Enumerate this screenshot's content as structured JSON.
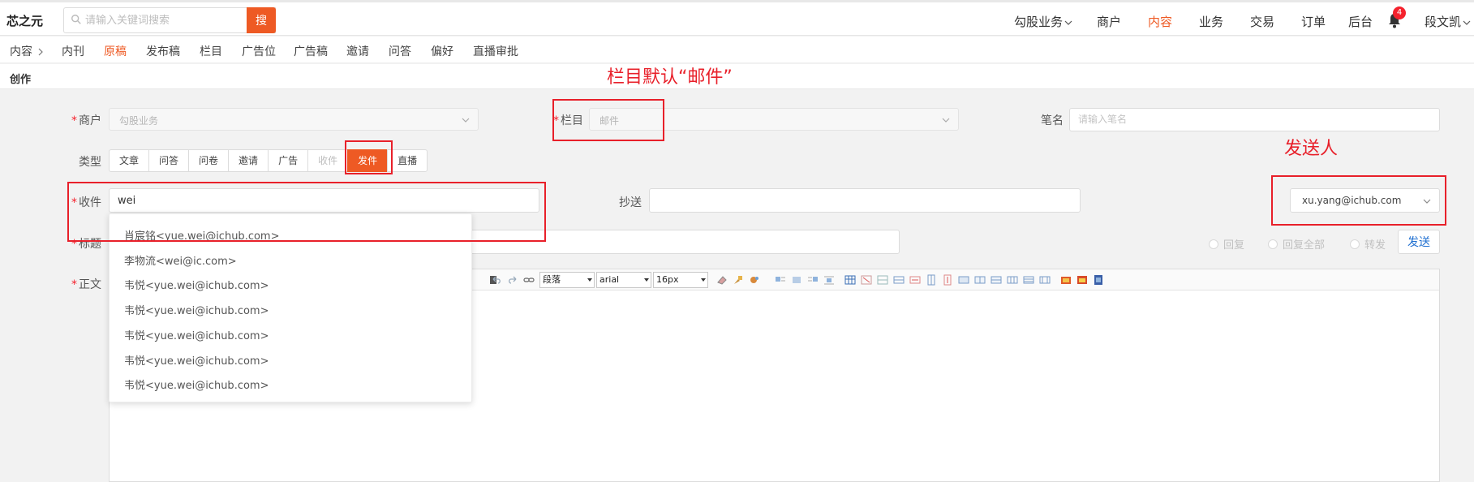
{
  "header": {
    "logo": "芯之元",
    "search_placeholder": "请输入关键词搜索",
    "search_button": "搜",
    "nav": [
      "勾股业务",
      "商户",
      "内容",
      "业务",
      "交易",
      "订单",
      "后台"
    ],
    "notification_count": "4",
    "user_name": "段文凯"
  },
  "subnav": {
    "root": "内容",
    "items": [
      "内刊",
      "原稿",
      "发布稿",
      "栏目",
      "广告位",
      "广告稿",
      "邀请",
      "问答",
      "偏好",
      "直播审批"
    ]
  },
  "page": {
    "title": "创作"
  },
  "form": {
    "merchant_label": "商户",
    "merchant_value": "勾股业务",
    "column_label": "栏目",
    "column_value": "邮件",
    "penname_label": "笔名",
    "penname_placeholder": "请输入笔名",
    "type_label": "类型",
    "types": [
      "文章",
      "问答",
      "问卷",
      "邀请",
      "广告",
      "收件",
      "发件",
      "直播"
    ],
    "recipient_label": "收件",
    "recipient_value": "wei",
    "cc_label": "抄送",
    "sender_value": "xu.yang@ichub.com",
    "title_label": "标题",
    "reply_options": [
      "回复",
      "回复全部",
      "转发"
    ],
    "send_button": "发送",
    "body_label": "正文"
  },
  "editor": {
    "paragraph": "段落",
    "font": "arial",
    "size": "16px"
  },
  "autocomplete": [
    "肖宸铭<yue.wei@ichub.com>",
    "李物流<wei@ic.com>",
    "韦悦<yue.wei@ichub.com>",
    "韦悦<yue.wei@ichub.com>",
    "韦悦<yue.wei@ichub.com>",
    "韦悦<yue.wei@ichub.com>",
    "韦悦<yue.wei@ichub.com>"
  ],
  "annotations": {
    "column_note": "栏目默认“邮件”",
    "sender_note": "发送人"
  },
  "colors": {
    "accent": "#ee5a24",
    "annotation": "#e8202a",
    "link": "#1f6fd0"
  }
}
